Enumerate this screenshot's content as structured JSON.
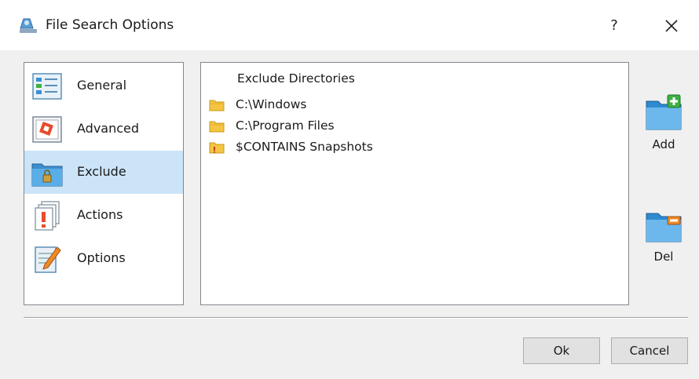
{
  "window": {
    "title": "File Search Options",
    "help_label": "?",
    "title_icon": "search-app-icon",
    "close_icon": "close-icon"
  },
  "nav": {
    "items": [
      {
        "label": "General",
        "icon": "general-icon",
        "selected": false
      },
      {
        "label": "Advanced",
        "icon": "advanced-icon",
        "selected": false
      },
      {
        "label": "Exclude",
        "icon": "exclude-folder-lock-icon",
        "selected": true
      },
      {
        "label": "Actions",
        "icon": "actions-icon",
        "selected": false
      },
      {
        "label": "Options",
        "icon": "options-icon",
        "selected": false
      }
    ]
  },
  "exclude": {
    "header": "Exclude Directories",
    "directories": [
      {
        "label": "C:\\Windows",
        "icon": "folder-icon"
      },
      {
        "label": "C:\\Program Files",
        "icon": "folder-icon"
      },
      {
        "label": "$CONTAINS Snapshots",
        "icon": "folder-contains-icon"
      }
    ]
  },
  "side_buttons": {
    "add_label": "Add",
    "del_label": "Del"
  },
  "footer": {
    "ok_label": "Ok",
    "cancel_label": "Cancel"
  },
  "colors": {
    "selection": "#cce4f7",
    "folder_yellow": "#f5c542",
    "accent_blue": "#1e90d8",
    "add_green": "#3cb043",
    "del_orange": "#f08a24"
  }
}
